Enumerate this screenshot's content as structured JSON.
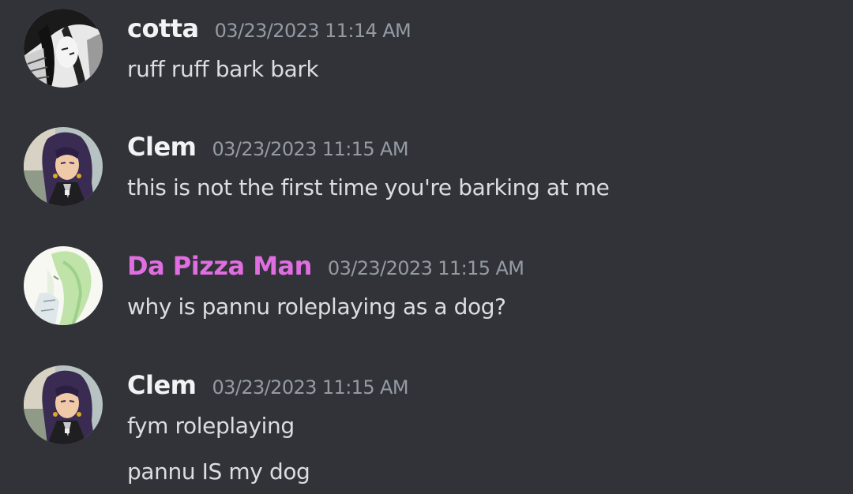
{
  "colors": {
    "background": "#313338",
    "username_default": "#f2f3f5",
    "username_role_pink": "#e06ee0",
    "timestamp": "#949ba4",
    "message_text": "#dbdee1"
  },
  "messages": [
    {
      "avatar": "monochrome-manga-avatar-icon",
      "author": "cotta",
      "author_color": "#f2f3f5",
      "timestamp": "03/23/2023 11:14 AM",
      "lines": [
        "ruff ruff bark bark"
      ]
    },
    {
      "avatar": "anime-woman-purple-hair-avatar-icon",
      "author": "Clem",
      "author_color": "#f2f3f5",
      "timestamp": "03/23/2023 11:15 AM",
      "lines": [
        "this is not the first time you're barking at me"
      ]
    },
    {
      "avatar": "green-hair-anime-avatar-icon",
      "author": "Da Pizza Man",
      "author_color": "#e06ee0",
      "timestamp": "03/23/2023 11:15 AM",
      "lines": [
        "why is pannu roleplaying as a dog?"
      ]
    },
    {
      "avatar": "anime-woman-purple-hair-avatar-icon",
      "author": "Clem",
      "author_color": "#f2f3f5",
      "timestamp": "03/23/2023 11:15 AM",
      "lines": [
        "fym roleplaying",
        "pannu IS my dog"
      ]
    }
  ]
}
